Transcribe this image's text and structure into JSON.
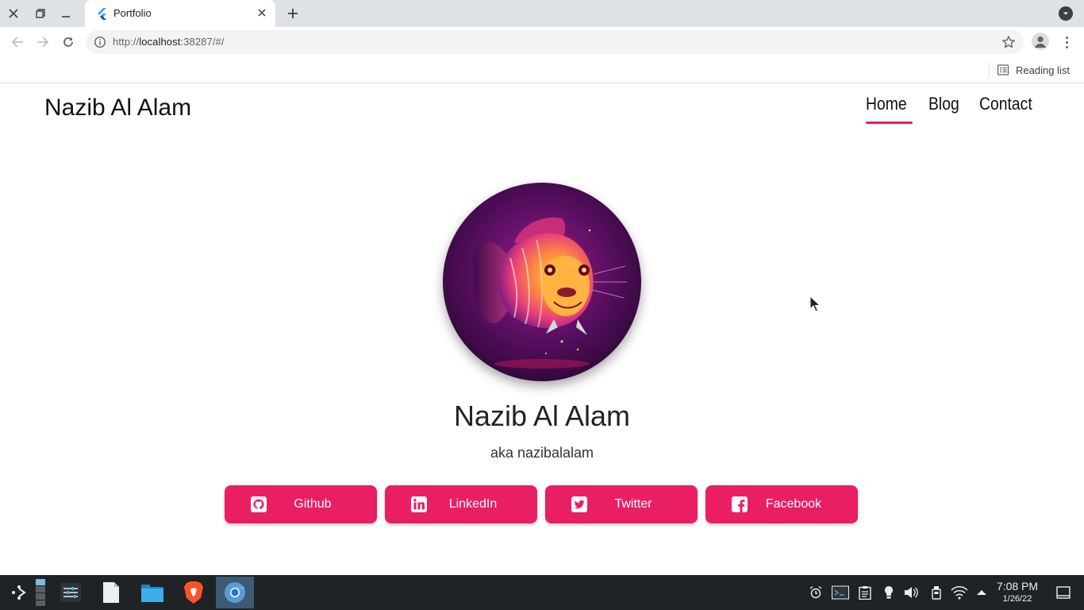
{
  "browser": {
    "tab_title": "Portfolio",
    "url_prefix": "http://",
    "url_host": "localhost",
    "url_rest": ":38287/#/",
    "reading_list_label": "Reading list"
  },
  "site": {
    "brand": "Nazib Al Alam",
    "nav": [
      {
        "label": "Home",
        "active": true
      },
      {
        "label": "Blog",
        "active": false
      },
      {
        "label": "Contact",
        "active": false
      }
    ],
    "hero_name": "Nazib Al Alam",
    "hero_sub": "aka nazibalalam",
    "socials": [
      {
        "label": "Github",
        "icon": "github-icon"
      },
      {
        "label": "LinkedIn",
        "icon": "linkedin-icon"
      },
      {
        "label": "Twitter",
        "icon": "twitter-icon"
      },
      {
        "label": "Facebook",
        "icon": "facebook-icon"
      }
    ],
    "accent_color": "#e91e63"
  },
  "taskbar": {
    "time": "7:08 PM",
    "date": "1/26/22"
  }
}
